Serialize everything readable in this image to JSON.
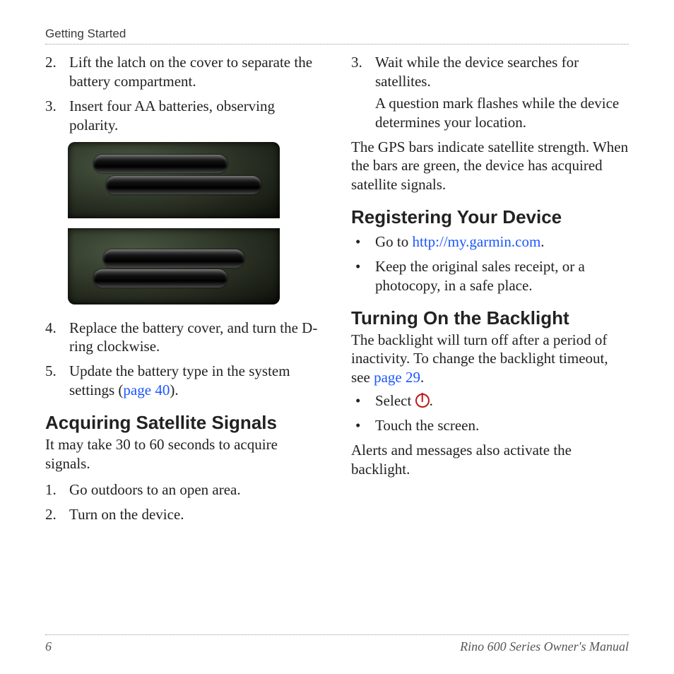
{
  "header": {
    "section": "Getting Started"
  },
  "left": {
    "steps": [
      {
        "n": "2.",
        "text": "Lift the latch on the cover to separate the battery compartment."
      },
      {
        "n": "3.",
        "text": "Insert four AA batteries, observing polarity."
      },
      {
        "n": "4.",
        "text_pre": "Replace the battery cover, and turn the D-ring clockwise."
      },
      {
        "n": "5.",
        "text_pre": "Update the battery type in the system settings (",
        "link": "page 40",
        "text_post": ")."
      }
    ],
    "h_acquiring": "Acquiring Satellite Signals",
    "acq_intro": "It may take 30 to 60 seconds to acquire signals.",
    "acq_steps": [
      {
        "n": "1.",
        "text": "Go outdoors to an open area."
      },
      {
        "n": "2.",
        "text": "Turn on the device."
      }
    ]
  },
  "right": {
    "step3": {
      "n": "3.",
      "text": "Wait while the device searches for satellites.",
      "sub": "A question mark flashes while the device determines your location."
    },
    "gps_para": "The GPS bars indicate satellite strength. When the bars are green, the device has acquired satellite signals.",
    "h_register": "Registering Your Device",
    "reg": [
      {
        "pre": "Go to ",
        "link": "http://my.garmin.com",
        "post": "."
      },
      {
        "pre": "Keep the original sales receipt, or a photocopy, in a safe place."
      }
    ],
    "h_backlight": "Turning On the Backlight",
    "bl_intro_pre": "The backlight will turn off after a period of inactivity. To change the backlight timeout, see ",
    "bl_intro_link": "page 29",
    "bl_intro_post": ".",
    "bl_list": [
      {
        "pre": "Select ",
        "icon": "power",
        "post": "."
      },
      {
        "pre": "Touch the screen."
      }
    ],
    "bl_outro": "Alerts and messages also activate the backlight."
  },
  "footer": {
    "page": "6",
    "title": "Rino 600 Series Owner's Manual"
  }
}
